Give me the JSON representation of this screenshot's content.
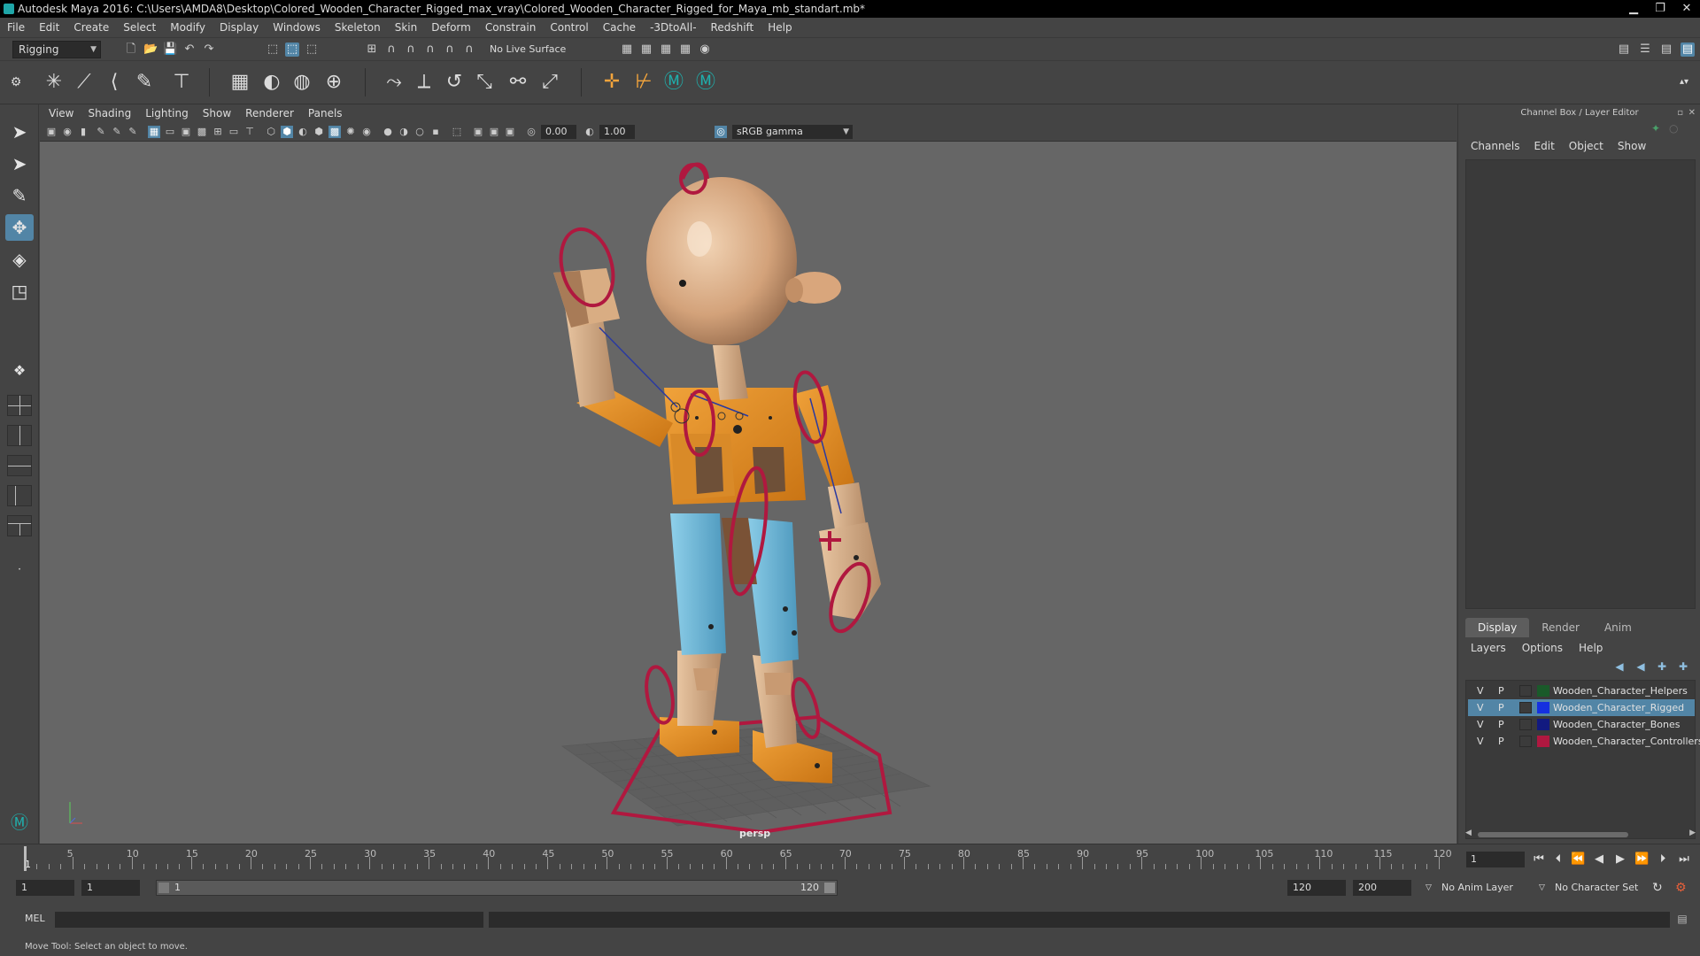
{
  "window": {
    "title": "Autodesk Maya 2016: C:\\Users\\AMDA8\\Desktop\\Colored_Wooden_Character_Rigged_max_vray\\Colored_Wooden_Character_Rigged_for_Maya_mb_standart.mb*"
  },
  "menubar": [
    "File",
    "Edit",
    "Create",
    "Select",
    "Modify",
    "Display",
    "Windows",
    "Skeleton",
    "Skin",
    "Deform",
    "Constrain",
    "Control",
    "Cache",
    "-3DtoAll-",
    "Redshift",
    "Help"
  ],
  "statusline": {
    "mode": "Rigging",
    "live_surface": "No Live Surface"
  },
  "viewport": {
    "menus": [
      "View",
      "Shading",
      "Lighting",
      "Show",
      "Renderer",
      "Panels"
    ],
    "exposure": "0.00",
    "gamma": "1.00",
    "color_space": "sRGB gamma",
    "camera": "persp"
  },
  "channel_box": {
    "title": "Channel Box / Layer Editor",
    "menus": [
      "Channels",
      "Edit",
      "Object",
      "Show"
    ],
    "tabs": [
      "Display",
      "Render",
      "Anim"
    ],
    "active_tab": "Display",
    "layer_menus": [
      "Layers",
      "Options",
      "Help"
    ],
    "layers": [
      {
        "v": "V",
        "p": "P",
        "name": "Wooden_Character_Helpers",
        "color": "#1a5a2a",
        "selected": false
      },
      {
        "v": "V",
        "p": "P",
        "name": "Wooden_Character_Rigged",
        "color": "#1530e0",
        "selected": true
      },
      {
        "v": "V",
        "p": "P",
        "name": "Wooden_Character_Bones",
        "color": "#121a80",
        "selected": false
      },
      {
        "v": "V",
        "p": "P",
        "name": "Wooden_Character_Controllers",
        "color": "#b01840",
        "selected": false
      }
    ]
  },
  "timeline": {
    "ticks": [
      "5",
      "10",
      "15",
      "20",
      "25",
      "30",
      "35",
      "40",
      "45",
      "50",
      "55",
      "60",
      "65",
      "70",
      "75",
      "80",
      "85",
      "90",
      "95",
      "100",
      "105",
      "110",
      "115",
      "120"
    ],
    "start_label": "1",
    "current_frame": "1",
    "range_start": "1",
    "range_start_2": "1",
    "range_bar_start": "1",
    "range_bar_end": "120",
    "range_end": "120",
    "anim_end": "200",
    "anim_layer": "No Anim Layer",
    "character_set": "No Character Set"
  },
  "command_line": {
    "label": "MEL"
  },
  "help_line": "Move Tool: Select an object to move."
}
